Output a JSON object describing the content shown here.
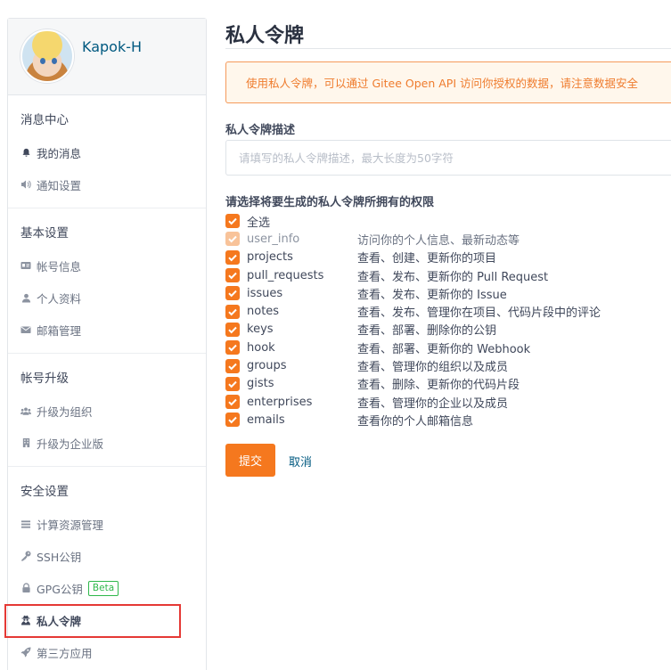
{
  "user": {
    "name": "Kapok-H"
  },
  "sidebar": {
    "groups": [
      {
        "title": "消息中心",
        "items": [
          {
            "label": "我的消息",
            "icon": "bell-icon"
          },
          {
            "label": "通知设置",
            "icon": "volume-icon"
          }
        ]
      },
      {
        "title": "基本设置",
        "items": [
          {
            "label": "帐号信息",
            "icon": "id-card-icon"
          },
          {
            "label": "个人资料",
            "icon": "user-icon"
          },
          {
            "label": "邮箱管理",
            "icon": "mail-icon"
          }
        ]
      },
      {
        "title": "帐号升级",
        "items": [
          {
            "label": "升级为组织",
            "icon": "users-icon"
          },
          {
            "label": "升级为企业版",
            "icon": "building-icon"
          }
        ]
      },
      {
        "title": "安全设置",
        "items": [
          {
            "label": "计算资源管理",
            "icon": "list-icon"
          },
          {
            "label": "SSH公钥",
            "icon": "key-icon"
          },
          {
            "label": "GPG公钥",
            "icon": "lock-icon",
            "badge": "Beta"
          },
          {
            "label": "私人令牌",
            "icon": "user-secret-icon",
            "active": true
          },
          {
            "label": "第三方应用",
            "icon": "rocket-icon"
          }
        ]
      }
    ]
  },
  "main": {
    "title": "私人令牌",
    "notice": "使用私人令牌，可以通过 Gitee Open API 访问你授权的数据，请注意数据安全",
    "desc_label": "私人令牌描述",
    "desc_placeholder": "请填写的私人令牌描述，最大长度为50字符",
    "perm_label": "请选择将要生成的私人令牌所拥有的权限",
    "select_all": "全选",
    "permissions": [
      {
        "name": "user_info",
        "desc": "访问你的个人信息、最新动态等",
        "checked": true,
        "disabled": true
      },
      {
        "name": "projects",
        "desc": "查看、创建、更新你的项目",
        "checked": true
      },
      {
        "name": "pull_requests",
        "desc": "查看、发布、更新你的 Pull Request",
        "checked": true
      },
      {
        "name": "issues",
        "desc": "查看、发布、更新你的 Issue",
        "checked": true
      },
      {
        "name": "notes",
        "desc": "查看、发布、管理你在项目、代码片段中的评论",
        "checked": true
      },
      {
        "name": "keys",
        "desc": "查看、部署、删除你的公钥",
        "checked": true
      },
      {
        "name": "hook",
        "desc": "查看、部署、更新你的 Webhook",
        "checked": true
      },
      {
        "name": "groups",
        "desc": "查看、管理你的组织以及成员",
        "checked": true
      },
      {
        "name": "gists",
        "desc": "查看、删除、更新你的代码片段",
        "checked": true
      },
      {
        "name": "enterprises",
        "desc": "查看、管理你的企业以及成员",
        "checked": true
      },
      {
        "name": "emails",
        "desc": "查看你的个人邮箱信息",
        "checked": true
      }
    ],
    "submit_label": "提交",
    "cancel_label": "取消"
  },
  "colors": {
    "accent": "#f5781e",
    "link": "#005980",
    "highlight": "#e53935",
    "beta": "#2fb84b"
  }
}
